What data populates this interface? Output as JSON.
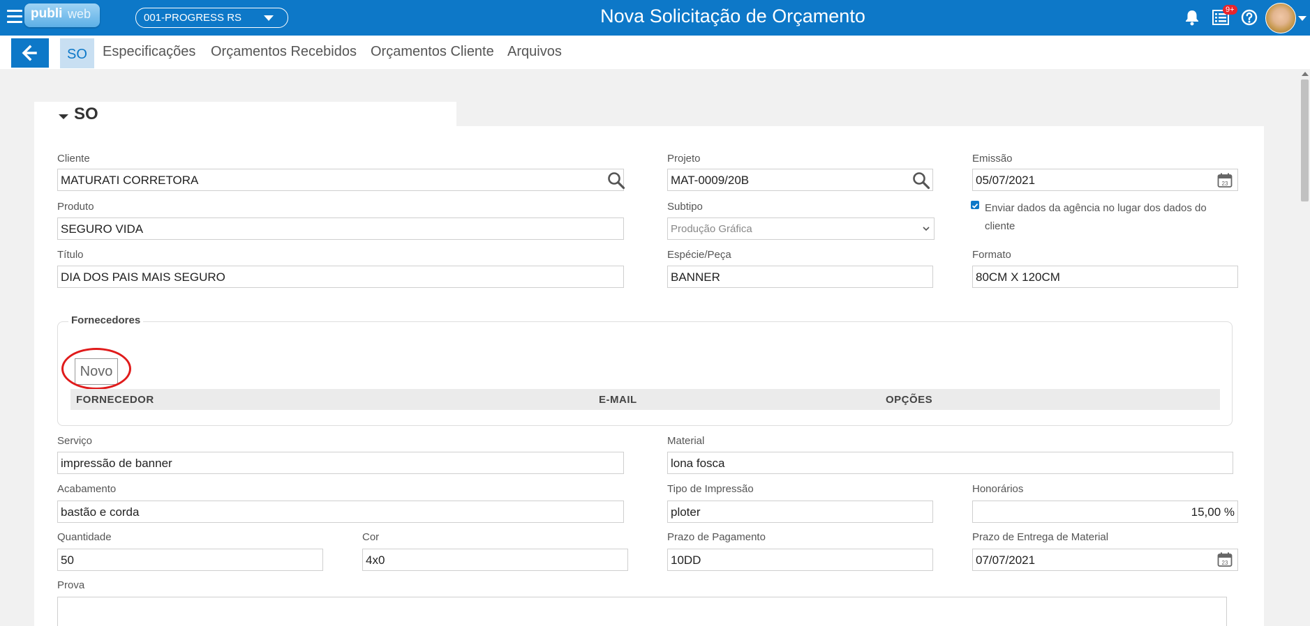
{
  "header": {
    "logo_left": "publi",
    "logo_right": "web",
    "company": "001-PROGRESS RS",
    "title": "Nova Solicitação de Orçamento",
    "notification_badge": "9+",
    "colors": {
      "primary": "#0d78c8",
      "highlight_circle": "#e01b1b"
    }
  },
  "tabs": [
    {
      "label": "SO"
    },
    {
      "label": "Especificações"
    },
    {
      "label": "Orçamentos Recebidos"
    },
    {
      "label": "Orçamentos Cliente"
    },
    {
      "label": "Arquivos"
    }
  ],
  "section": {
    "title": "SO"
  },
  "form": {
    "cliente": {
      "label": "Cliente",
      "value": "MATURATI CORRETORA"
    },
    "projeto": {
      "label": "Projeto",
      "value": "MAT-0009/20B"
    },
    "emissao": {
      "label": "Emissão",
      "value": "05/07/2021"
    },
    "produto": {
      "label": "Produto",
      "value": "SEGURO VIDA"
    },
    "subtipo": {
      "label": "Subtipo",
      "value": "Produção Gráfica"
    },
    "enviar_dados": {
      "label": "Enviar dados da agência no lugar dos dados do cliente",
      "checked": true
    },
    "titulo": {
      "label": "Título",
      "value": "DIA DOS PAIS MAIS SEGURO"
    },
    "especie": {
      "label": "Espécie/Peça",
      "value": "BANNER"
    },
    "formato": {
      "label": "Formato",
      "value": "80CM X 120CM"
    },
    "servico": {
      "label": "Serviço",
      "value": "impressão de banner"
    },
    "material": {
      "label": "Material",
      "value": "lona fosca"
    },
    "acabamento": {
      "label": "Acabamento",
      "value": "bastão e corda"
    },
    "tipo_impressao": {
      "label": "Tipo de Impressão",
      "value": "ploter"
    },
    "honorarios": {
      "label": "Honorários",
      "value": "15,00 %"
    },
    "quantidade": {
      "label": "Quantidade",
      "value": "50"
    },
    "cor": {
      "label": "Cor",
      "value": "4x0"
    },
    "prazo_pagamento": {
      "label": "Prazo de Pagamento",
      "value": "10DD"
    },
    "prazo_entrega": {
      "label": "Prazo de Entrega de Material",
      "value": "07/07/2021"
    },
    "prova": {
      "label": "Prova",
      "value": ""
    }
  },
  "fornecedores": {
    "legend": "Fornecedores",
    "new_button": "Novo",
    "columns": [
      "FORNECEDOR",
      "E-MAIL",
      "OPÇÕES"
    ]
  }
}
